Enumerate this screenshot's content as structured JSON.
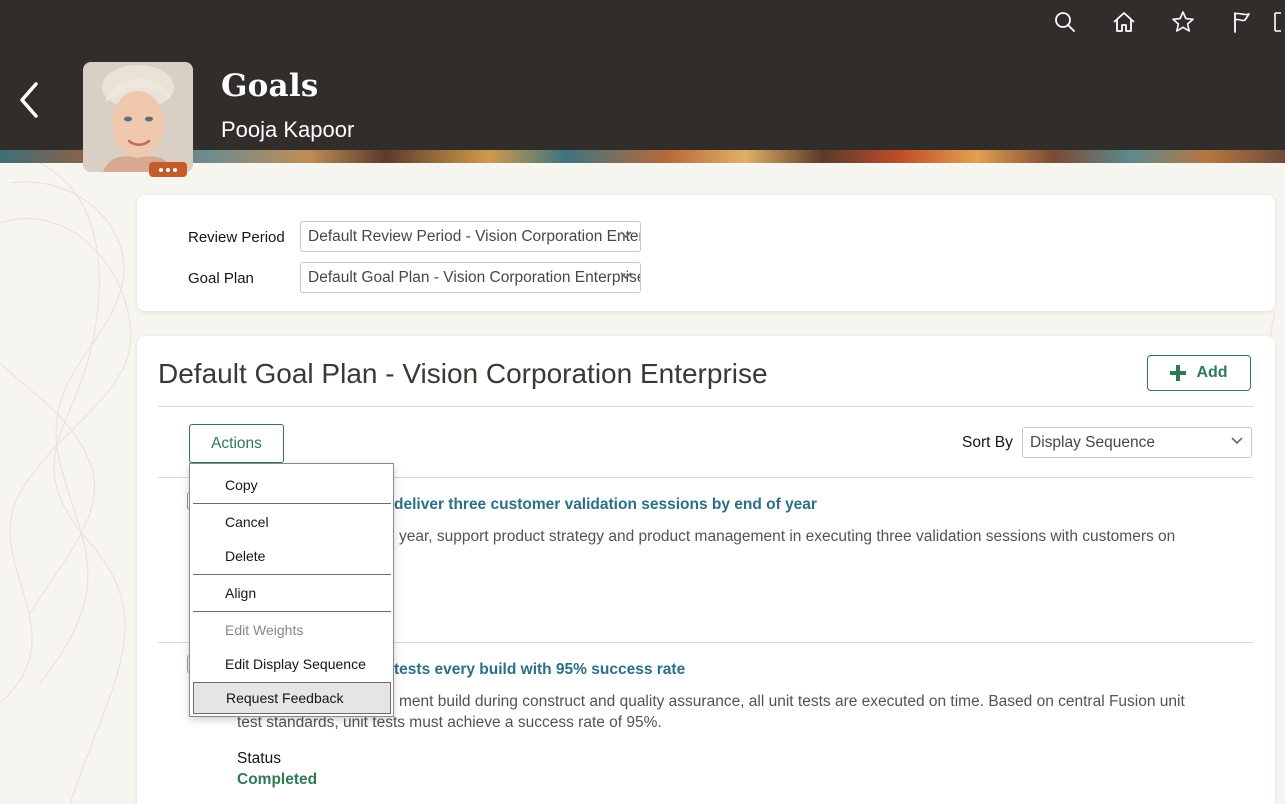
{
  "header": {
    "page_title": "Goals",
    "person_name": "Pooja Kapoor",
    "icons": [
      "search-icon",
      "home-icon",
      "star-icon",
      "flag-icon",
      "more-icon"
    ]
  },
  "filters": {
    "review_period_label": "Review Period",
    "review_period_value": "Default Review Period - Vision Corporation Enterprise",
    "goal_plan_label": "Goal Plan",
    "goal_plan_value": "Default Goal Plan - Vision Corporation Enterprise"
  },
  "main": {
    "plan_title": "Default Goal Plan - Vision Corporation Enterprise",
    "add_label": "Add",
    "actions_label": "Actions",
    "sort_by_label": "Sort By",
    "sort_by_value": "Display Sequence"
  },
  "goals": [
    {
      "title_visible": "deliver three customer validation sessions by end of year",
      "desc_visible": "year, support product strategy and product management in executing three validation sessions with customers on"
    },
    {
      "title_visible": "tests every build with 95% success rate",
      "desc_line1_visible": "ment build during construct and quality assurance, all unit tests are executed on time. Based on central Fusion unit",
      "desc_line2": "test standards, unit tests must achieve a success rate of 95%.",
      "status_label": "Status",
      "status_value": "Completed"
    }
  ],
  "actions_menu": {
    "items": [
      {
        "label": "Copy",
        "enabled": true
      },
      {
        "label": "Cancel",
        "enabled": true
      },
      {
        "label": "Delete",
        "enabled": true
      },
      {
        "label": "Align",
        "enabled": true
      },
      {
        "label": "Edit Weights",
        "enabled": false
      },
      {
        "label": "Edit Display Sequence",
        "enabled": true
      },
      {
        "label": "Request Feedback",
        "enabled": true,
        "highlighted": true
      }
    ]
  },
  "colors": {
    "header_bg": "#312d2a",
    "accent_green": "#2f7a54",
    "link_teal": "#2b6f88",
    "more_badge": "#c55a2b"
  }
}
